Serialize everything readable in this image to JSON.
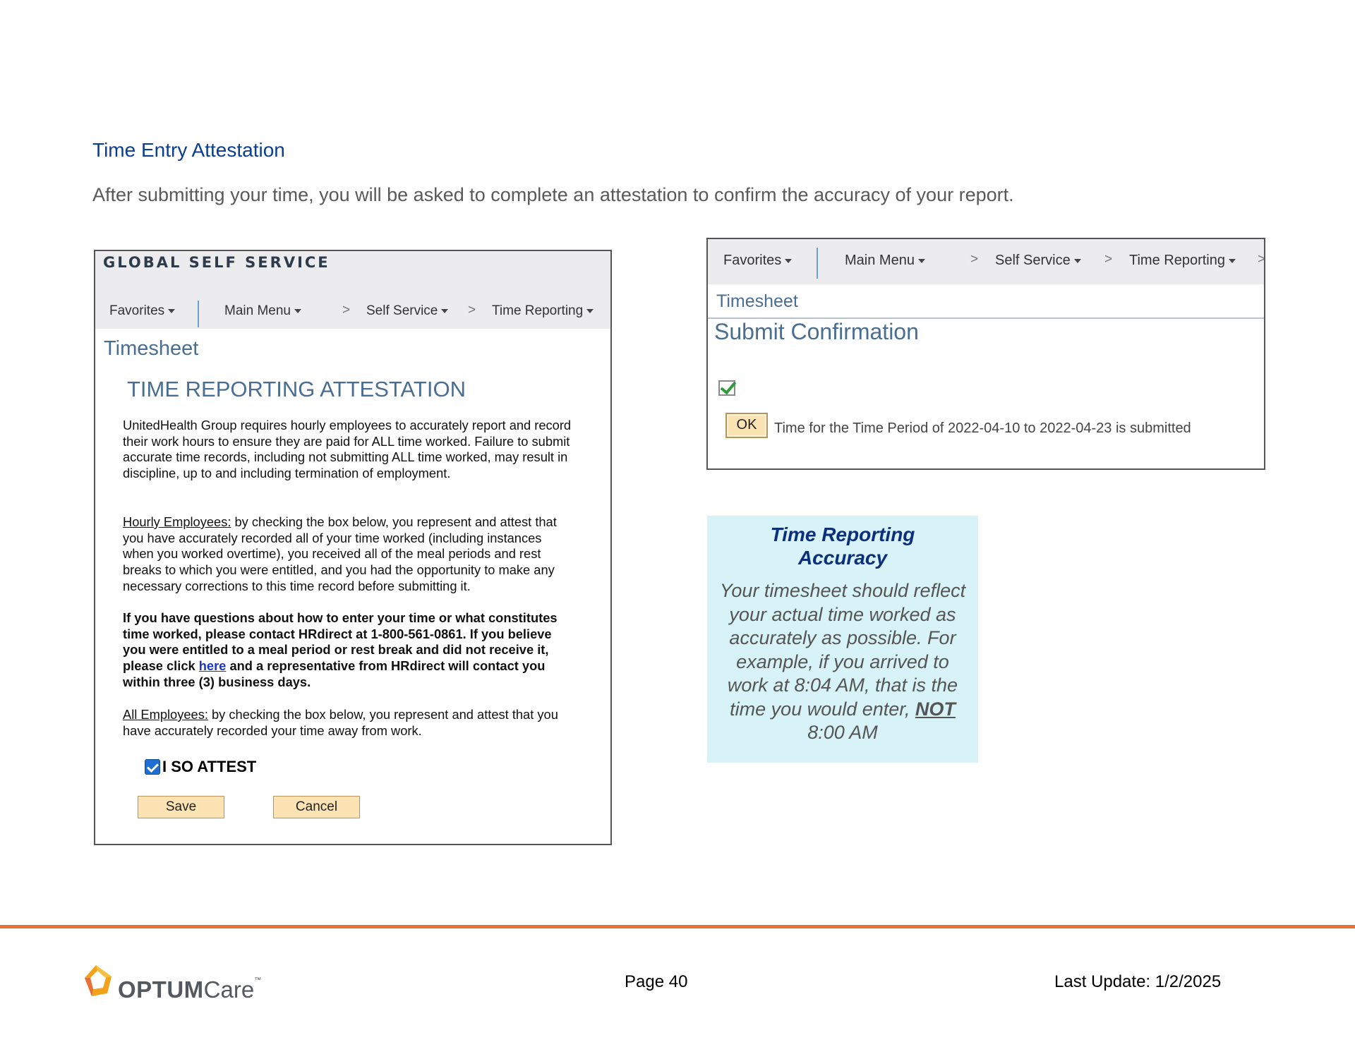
{
  "heading": "Time Entry Attestation",
  "intro": "After submitting your time, you will be asked to complete an attestation to confirm the accuracy of your report.",
  "left_screenshot": {
    "banner": "GLOBAL SELF SERVICE",
    "nav": {
      "favorites": "Favorites",
      "main_menu": "Main Menu",
      "self_service": "Self Service",
      "time_reporting": "Time Reporting",
      "arrow": ">"
    },
    "page_title": "Timesheet",
    "attestation_title": "TIME REPORTING ATTESTATION",
    "para1": "UnitedHealth Group requires hourly employees to accurately report and record their work hours to ensure they are paid for ALL time worked. Failure to submit accurate time records, including not submitting ALL time worked, may result in discipline, up to and including termination of employment.",
    "para2_label": "Hourly Employees:",
    "para2_text": " by checking the box below, you represent and attest that you have accurately recorded all of your time worked (including instances when you worked overtime), you received all of the meal periods and rest breaks to which you were entitled, and you had the opportunity to make any necessary corrections to this time record before submitting it.",
    "para3_before": "If you have questions about how to enter your time or what constitutes time worked, please contact HRdirect at 1-800-561-0861. If you believe you were entitled to a meal period or rest break and did not receive it, please click ",
    "para3_link": "here",
    "para3_after": " and a representative from HRdirect will contact you within three (3) business days.",
    "para4_label": "All Employees:",
    "para4_text": " by checking the box below, you represent and attest that you have accurately recorded your time away from work.",
    "attest_label": "I SO ATTEST",
    "attest_checked": true,
    "save_label": "Save",
    "cancel_label": "Cancel"
  },
  "right_screenshot": {
    "nav": {
      "favorites": "Favorites",
      "main_menu": "Main Menu",
      "self_service": "Self Service",
      "time_reporting": "Time Reporting",
      "arrow": ">"
    },
    "page_title": "Timesheet",
    "confirmation_title": "Submit Confirmation",
    "ok_label": "OK",
    "message": "Time for the Time Period of 2022-04-10 to  2022-04-23 is submitted"
  },
  "callout": {
    "title_line1": "Time Reporting",
    "title_line2": "Accuracy",
    "body_before": "Your timesheet should reflect your actual time worked as accurately as possible. For example, if you arrived to work at 8:04 AM, that is the time you would enter, ",
    "body_not": "NOT",
    "body_after": " 8:00 AM"
  },
  "footer": {
    "logo_optum": "OPTUM",
    "logo_care": "Care",
    "logo_tm": "™",
    "page": "Page 40",
    "last_update": "Last Update: 1/2/2025"
  },
  "colors": {
    "heading_blue": "#0b3d91",
    "footer_rule": "#e8703b",
    "callout_bg": "#d7f3f8",
    "button_bg": "#fbe3b4"
  }
}
